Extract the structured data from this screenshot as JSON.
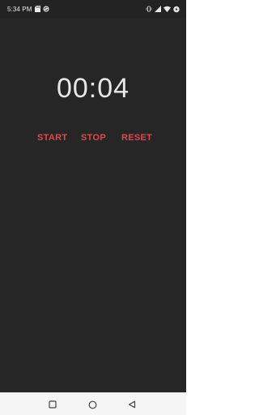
{
  "status_bar": {
    "time": "5:34 PM",
    "icons_left": [
      "sd-card-icon",
      "sync-icon"
    ],
    "icons_right": [
      "vibrate-icon",
      "signal-icon",
      "wifi-icon",
      "battery-icon"
    ]
  },
  "stopwatch": {
    "display": "00:04"
  },
  "controls": {
    "start_label": "START",
    "stop_label": "STOP",
    "reset_label": "RESET"
  },
  "nav_bar": {
    "icons": [
      "recents-square-icon",
      "home-circle-icon",
      "back-triangle-icon"
    ]
  },
  "colors": {
    "background": "#262626",
    "accent": "#e0474c",
    "timer_text": "#e8e8e8",
    "nav_bar": "#f5f5f5"
  }
}
